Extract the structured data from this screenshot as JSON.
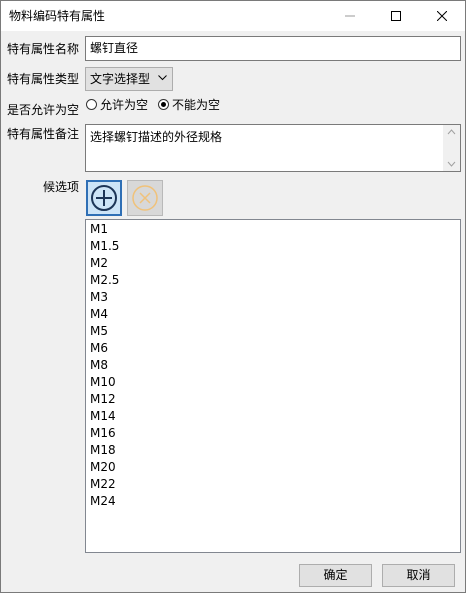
{
  "window": {
    "title": "物料编码特有属性"
  },
  "form": {
    "name_label": "特有属性名称",
    "name_value": "螺钉直径",
    "type_label": "特有属性类型",
    "type_value": "文字选择型",
    "nullable_label": "是否允许为空",
    "radio_allow": "允许为空",
    "radio_deny": "不能为空",
    "nullable_selected": "不能为空",
    "remark_label": "特有属性备注",
    "remark_value": "选择螺钉描述的外径规格",
    "candidates_label": "候选项"
  },
  "candidates": [
    "M1",
    "M1.5",
    "M2",
    "M2.5",
    "M3",
    "M4",
    "M5",
    "M6",
    "M8",
    "M10",
    "M12",
    "M14",
    "M16",
    "M18",
    "M20",
    "M22",
    "M24"
  ],
  "buttons": {
    "ok": "确定",
    "cancel": "取消"
  },
  "icons": {
    "add": "plus-circle-icon",
    "delete": "x-circle-icon",
    "minimize": "minimize-icon",
    "maximize": "maximize-icon",
    "close": "close-icon",
    "dropdown": "chevron-down-icon"
  },
  "colors": {
    "accent": "#2f6fb5",
    "add_bg": "#cde4f7",
    "delete_icon": "#f0c27a"
  }
}
